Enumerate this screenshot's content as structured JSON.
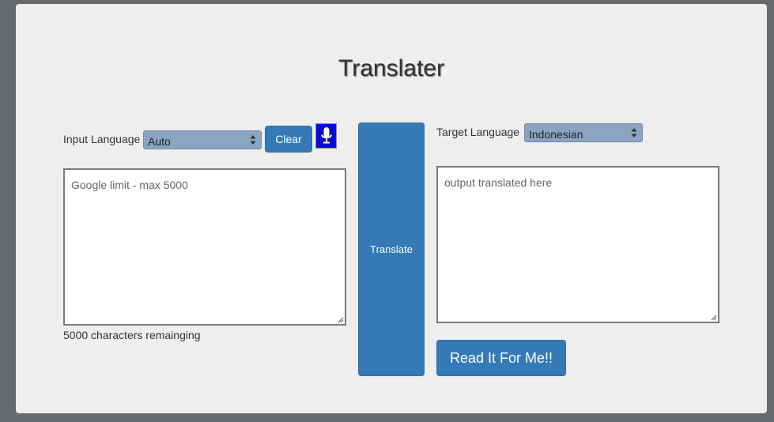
{
  "page": {
    "title": "Translater"
  },
  "input": {
    "language_label": "Input Language",
    "language_value": "Auto",
    "clear_label": "Clear",
    "placeholder": "Google limit - max 5000",
    "remaining_text": "5000 characters remainging"
  },
  "translate_label": "Translate",
  "output": {
    "language_label": "Target Language",
    "language_value": "Indonesian",
    "placeholder": "output translated here",
    "read_label": "Read It For Me!!"
  },
  "icons": {
    "mic": "microphone-icon",
    "select_arrows": "chevron-updown-icon",
    "resize": "resize-grip-icon"
  },
  "colors": {
    "background": "#666a6d",
    "panel": "#eeeeee",
    "button": "#337ab7",
    "select": "#8aa4c2",
    "mic_button": "#0a0ad6"
  }
}
